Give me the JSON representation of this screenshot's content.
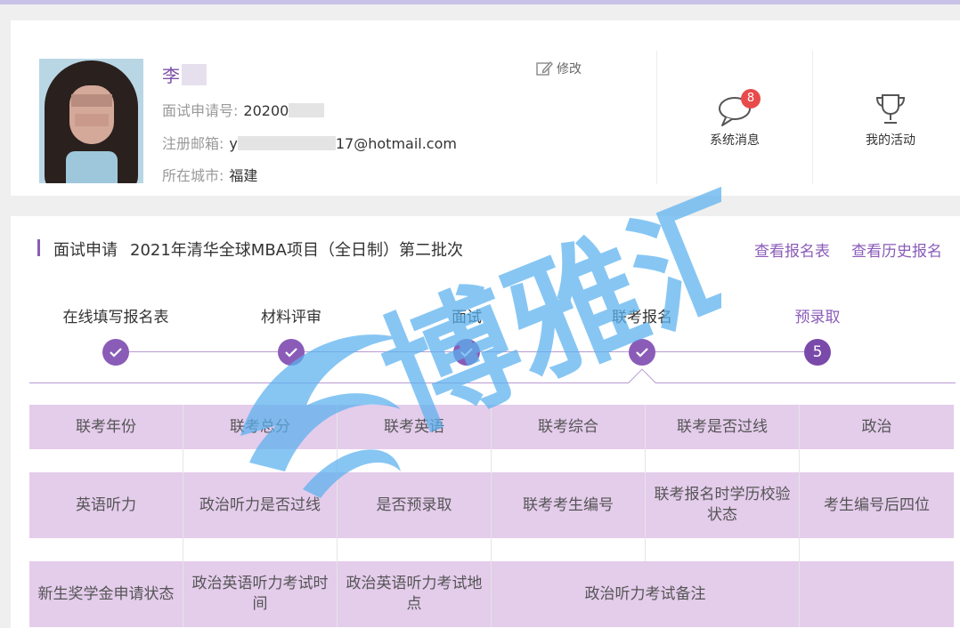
{
  "profile": {
    "name": "李",
    "edit_label": "修改",
    "application_no_label": "面试申请号:",
    "application_no_value": "20200",
    "email_label": "注册邮箱:",
    "email_prefix": "y",
    "email_suffix": "17@hotmail.com",
    "city_label": "所在城市:",
    "city_value": "福建"
  },
  "side": {
    "messages_label": "系统消息",
    "messages_badge": "8",
    "activities_label": "我的活动"
  },
  "application": {
    "section_label": "面试申请",
    "program": "2021年清华全球MBA项目（全日制）第二批次",
    "link_view_form": "查看报名表",
    "link_history": "查看历史报名"
  },
  "steps": [
    {
      "label": "在线填写报名表",
      "state": "done"
    },
    {
      "label": "材料评审",
      "state": "done"
    },
    {
      "label": "面试",
      "state": "done"
    },
    {
      "label": "联考报名",
      "state": "done"
    },
    {
      "label": "预录取",
      "state": "current",
      "number": "5"
    }
  ],
  "table": {
    "row1": [
      "联考年份",
      "联考总分",
      "联考英语",
      "联考综合",
      "联考是否过线",
      "政治"
    ],
    "row2": [
      "英语听力",
      "政治听力是否过线",
      "是否预录取",
      "联考考生编号",
      "联考报名时学历校验状态",
      "考生编号后四位"
    ],
    "row3": [
      "新生奖学金申请状态",
      "政治英语听力考试时间",
      "政治英语听力考试地点",
      "政治听力考试备注"
    ]
  },
  "watermark_text": "博雅汇",
  "colors": {
    "accent": "#8a5cb8",
    "header_bg": "#e4cceb",
    "badge": "#e84b4b",
    "watermark": "#5ab1ef"
  }
}
